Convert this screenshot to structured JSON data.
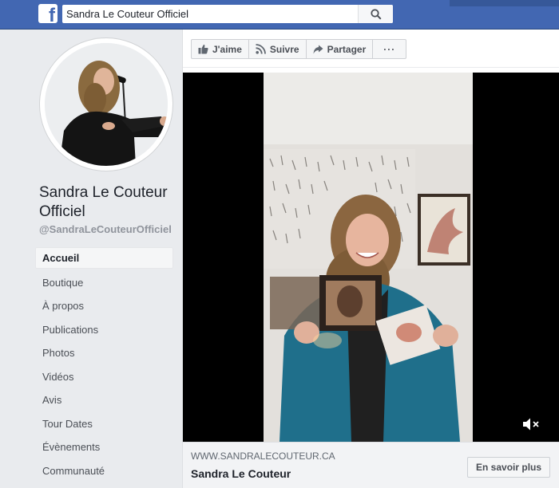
{
  "topbar": {
    "logo": "f",
    "search_value": "Sandra Le Couteur Officiel",
    "search_icon": "search-icon"
  },
  "profile": {
    "name": "Sandra Le Couteur Officiel",
    "handle": "@SandraLeCouteurOfficiel"
  },
  "nav": {
    "items": [
      {
        "label": "Accueil",
        "active": true
      },
      {
        "label": "Boutique"
      },
      {
        "label": "À propos"
      },
      {
        "label": "Publications"
      },
      {
        "label": "Photos"
      },
      {
        "label": "Vidéos"
      },
      {
        "label": "Avis"
      },
      {
        "label": "Tour Dates"
      },
      {
        "label": "Évènements"
      },
      {
        "label": "Communauté"
      }
    ]
  },
  "actions": {
    "like": "J'aime",
    "follow": "Suivre",
    "share": "Partager",
    "more": "···"
  },
  "video": {
    "mute_icon": "muted-speaker-icon"
  },
  "link": {
    "domain": "WWW.SANDRALECOUTEUR.CA",
    "title": "Sandra Le Couteur",
    "cta": "En savoir plus"
  },
  "colors": {
    "brand": "#4267b2",
    "background": "#e9ebee"
  }
}
